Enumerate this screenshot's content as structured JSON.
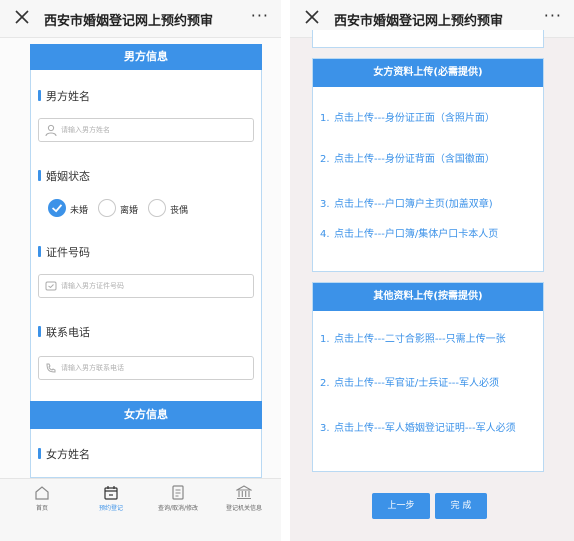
{
  "left": {
    "title": "西安市婚姻登记网上预约预审",
    "more": "···",
    "male_section": "男方信息",
    "male_name_label": "男方姓名",
    "male_name_placeholder": "请输入男方姓名",
    "marital_label": "婚姻状态",
    "marital_options": [
      "未婚",
      "离婚",
      "丧偶"
    ],
    "marital_selected": "未婚",
    "id_label": "证件号码",
    "id_placeholder": "请输入男方证件号码",
    "phone_label": "联系电话",
    "phone_placeholder": "请输入男方联系电话",
    "female_section": "女方信息",
    "female_name_label": "女方姓名",
    "tabs": [
      {
        "label": "首页",
        "icon": "home-icon"
      },
      {
        "label": "预约登记",
        "icon": "calendar-icon"
      },
      {
        "label": "查询/取消/修改",
        "icon": "document-icon"
      },
      {
        "label": "登记机关信息",
        "icon": "building-icon"
      }
    ],
    "active_tab": "预约登记"
  },
  "right": {
    "title": "西安市婚姻登记网上预约预审",
    "more": "···",
    "female_upload_header": "女方资料上传(必需提供)",
    "female_items": [
      {
        "num": "1.",
        "text": "点击上传---身份证正面（含照片面）"
      },
      {
        "num": "2.",
        "text": "点击上传---身份证背面（含国徽面）"
      },
      {
        "num": "3.",
        "text": "点击上传---户口簿户主页(加盖双章)"
      },
      {
        "num": "4.",
        "text": "点击上传---户口簿/集体户口卡本人页"
      }
    ],
    "other_upload_header": "其他资料上传(按需提供)",
    "other_items": [
      {
        "num": "1.",
        "text": "点击上传---二寸合影照---只需上传一张"
      },
      {
        "num": "2.",
        "text": "点击上传---军官证/士兵证---军人必须"
      },
      {
        "num": "3.",
        "text": "点击上传---军人婚姻登记证明---军人必须"
      }
    ],
    "prev_button": "上一步",
    "done_button": "完 成"
  },
  "colors": {
    "accent": "#3c92e8",
    "border": "#b9d9f3"
  }
}
